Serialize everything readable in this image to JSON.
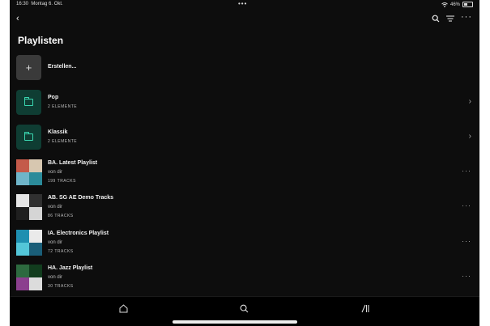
{
  "status": {
    "time": "16:30",
    "date": "Montag 6. Okt.",
    "dots": "•••",
    "battery": "46%"
  },
  "header": {
    "back_icon": "chevron-left-icon",
    "title": "Playlisten"
  },
  "create": {
    "icon": "plus-icon",
    "label": "Erstellen..."
  },
  "folders": [
    {
      "name": "Pop",
      "meta": "2 ELEMENTE"
    },
    {
      "name": "Klassik",
      "meta": "2 ELEMENTE"
    }
  ],
  "playlists": [
    {
      "title": "BA. Latest Playlist",
      "owner": "von dir",
      "meta": "199 TRACKS",
      "art": [
        "#c45a4a",
        "#d7c7b0",
        "#6fb5c9",
        "#2b8b9a"
      ]
    },
    {
      "title": "AB. SG AE Demo Tracks",
      "owner": "von dir",
      "meta": "86 TRACKS",
      "art": [
        "#e6e6e6",
        "#303030",
        "#1f1f1f",
        "#d5d5d5"
      ]
    },
    {
      "title": "IA. Electronics Playlist",
      "owner": "von dir",
      "meta": "72 TRACKS",
      "art": [
        "#1e8fb0",
        "#eaeaea",
        "#53c6d8",
        "#1a5e78"
      ]
    },
    {
      "title": "HA. Jazz Playlist",
      "owner": "von dir",
      "meta": "30 TRACKS",
      "art": [
        "#2d6a3f",
        "#123d1e",
        "#8b3f8e",
        "#dcdcdc"
      ]
    }
  ],
  "tabbar": {
    "home": "home-icon",
    "search": "search-icon",
    "library": "library-icon"
  },
  "colors": {
    "background": "#0d0d0d",
    "folder_tile": "#0f3d33",
    "folder_accent": "#3ad6b0"
  }
}
